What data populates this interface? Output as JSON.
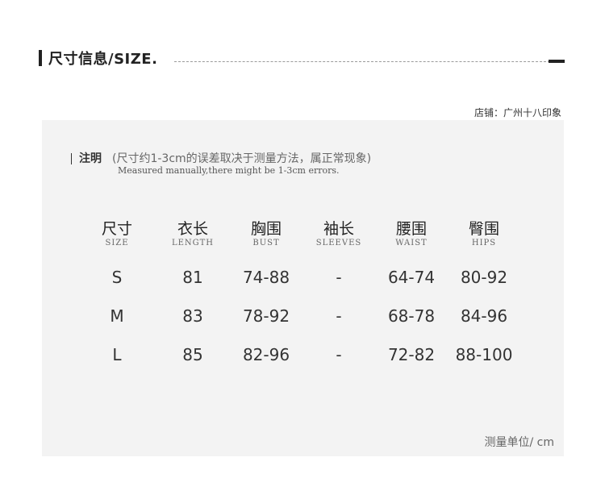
{
  "header": {
    "title": "尺寸信息/SIZE."
  },
  "shop": {
    "label": "店铺：广州十八印象"
  },
  "note": {
    "label": "注明",
    "cn": "(尺寸约1-3cm的误差取决于测量方法，属正常现象)",
    "en": "Measured manually,there might be 1-3cm errors."
  },
  "table": {
    "headers": [
      {
        "cn": "尺寸",
        "en": "SIZE"
      },
      {
        "cn": "衣长",
        "en": "LENGTH"
      },
      {
        "cn": "胸围",
        "en": "BUST"
      },
      {
        "cn": "袖长",
        "en": "SLEEVES"
      },
      {
        "cn": "腰围",
        "en": "WAIST"
      },
      {
        "cn": "臀围",
        "en": "HIPS"
      }
    ],
    "rows": [
      [
        "S",
        "81",
        "74-88",
        "-",
        "64-74",
        "80-92"
      ],
      [
        "M",
        "83",
        "78-92",
        "-",
        "68-78",
        "84-96"
      ],
      [
        "L",
        "85",
        "82-96",
        "-",
        "72-82",
        "88-100"
      ]
    ]
  },
  "unit": {
    "label": "测量单位/ cm"
  }
}
